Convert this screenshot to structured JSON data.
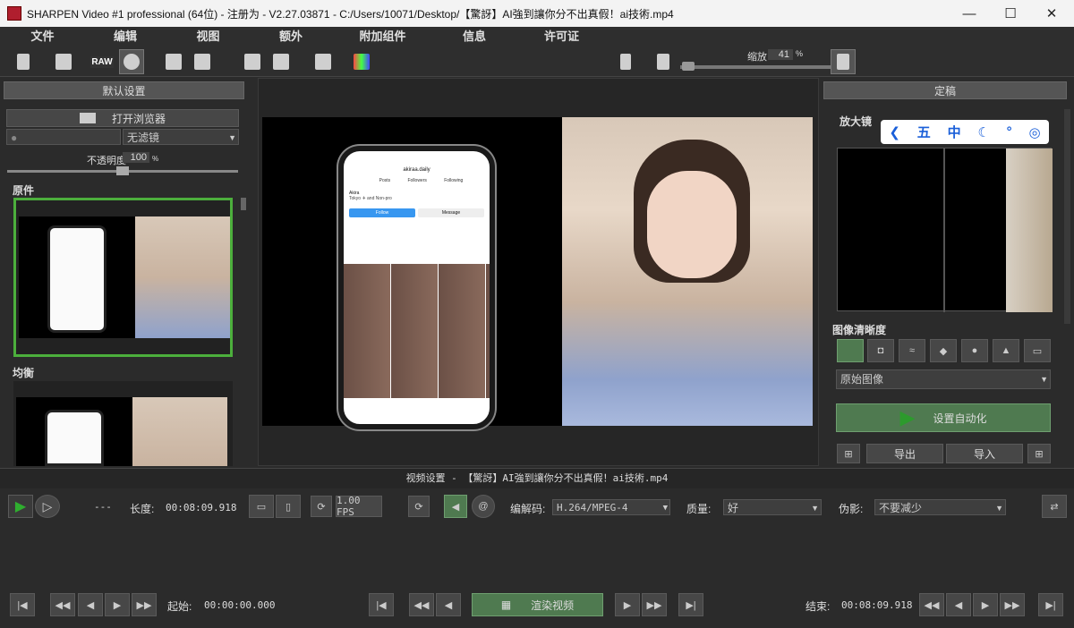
{
  "window": {
    "title": "SHARPEN Video #1 professional (64位) - 注册为 - V2.27.03871 - C:/Users/10071/Desktop/【驚訝】AI強到讓你分不出真假！ai技術.mp4",
    "minimize": "—",
    "maximize": "☐",
    "close": "✕"
  },
  "menu": [
    "文件",
    "编辑",
    "视图",
    "额外",
    "附加组件",
    "信息",
    "许可证"
  ],
  "toolbar": {
    "zoom_label": "缩放",
    "zoom_value": "41",
    "zoom_unit": "%",
    "raw_label": "RAW"
  },
  "left": {
    "header": "默认设置",
    "browser_button": "打开浏览器",
    "filter": "无滤镜",
    "opacity_label": "不透明度",
    "opacity_value": "100",
    "opacity_unit": "%",
    "preset1": "原件",
    "preset2": "均衡"
  },
  "right": {
    "header": "定稿",
    "magnifier": "放大镜",
    "sharpness": "图像清晰度",
    "mode": "原始图像",
    "auto_button": "设置自动化",
    "export": "导出",
    "import": "导入"
  },
  "overlay": {
    "glyphs": [
      "五",
      "中"
    ]
  },
  "phone": {
    "username": "akiraa.daily",
    "stats": [
      "Posts",
      "Followers",
      "Following"
    ],
    "name": "Akira",
    "bio": "Tokyo ✈ and Non-pro",
    "follow": "Follow",
    "message": "Message"
  },
  "video": {
    "header": "视频设置 - 【驚訝】AI強到讓你分不出真假！ai技術.mp4",
    "dash": "---",
    "length_label": "长度:",
    "length": "00:08:09.918",
    "fps": "1.00 FPS",
    "codec_label": "编解码:",
    "codec": "H.264/MPEG-4",
    "quality_label": "质量:",
    "quality": "好",
    "artifact_label": "伪影:",
    "artifact": "不要减少"
  },
  "timeline": {
    "start_label": "起始:",
    "start": "00:00:00.000",
    "render": "渲染视频",
    "end_label": "结束:",
    "end": "00:08:09.918"
  }
}
